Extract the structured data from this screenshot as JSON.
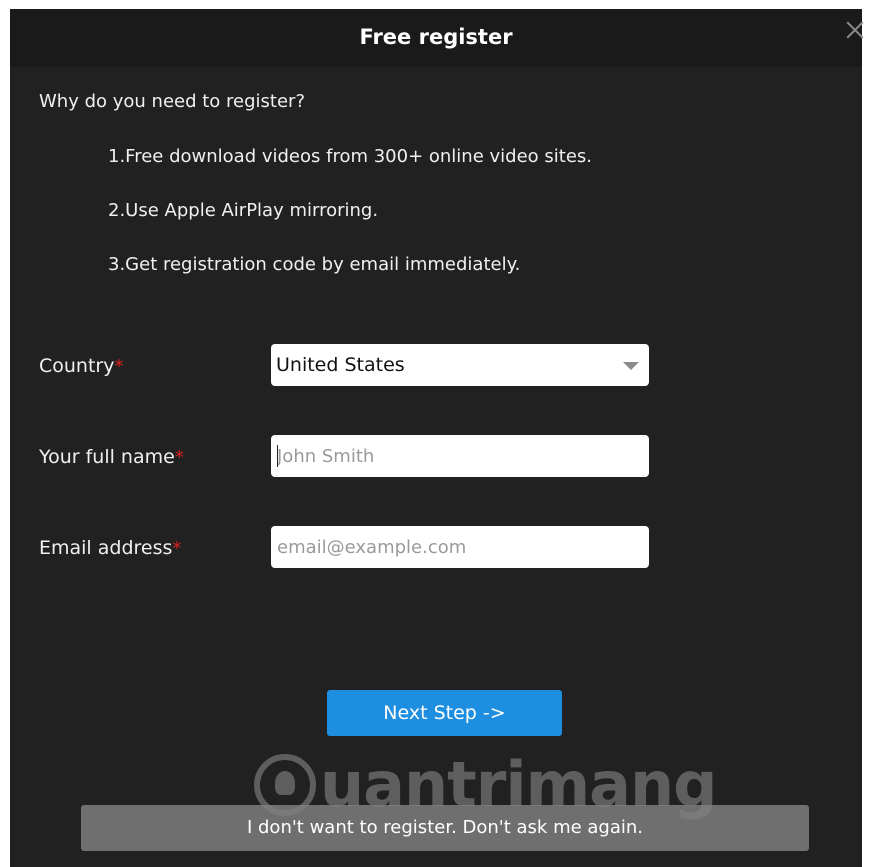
{
  "dialog": {
    "title": "Free register",
    "close_glyph": "close-icon"
  },
  "intro": {
    "question": "Why do you need to register?",
    "reasons": [
      "1.Free download videos from 300+ online video sites.",
      "2.Use Apple AirPlay mirroring.",
      "3.Get registration code by email immediately."
    ]
  },
  "form": {
    "country": {
      "label": "Country",
      "required_mark": "*",
      "value": "United States"
    },
    "full_name": {
      "label": "Your full name",
      "required_mark": "*",
      "value": "",
      "placeholder": "John Smith"
    },
    "email": {
      "label": "Email address",
      "required_mark": "*",
      "value": "",
      "placeholder": "email@example.com"
    }
  },
  "actions": {
    "next_label": "Next Step ->",
    "dont_ask_label": "I don't want to register. Don't ask me again."
  },
  "watermark": {
    "text": "uantrimang"
  },
  "colors": {
    "dialog_bg": "#212121",
    "accent": "#1e8fe0",
    "required": "#e02020"
  }
}
